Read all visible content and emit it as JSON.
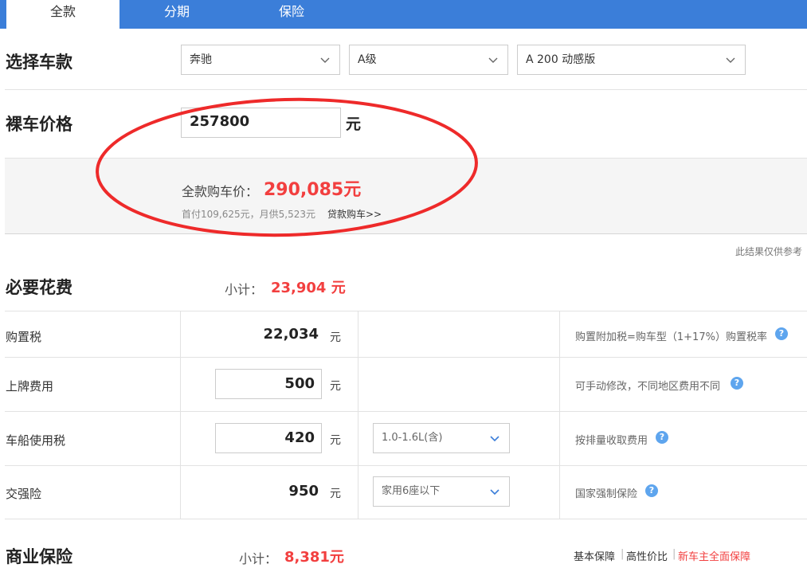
{
  "tabs": [
    {
      "label": "全款",
      "active": true
    },
    {
      "label": "分期",
      "active": false
    },
    {
      "label": "保险",
      "active": false
    }
  ],
  "select_model": {
    "title": "选择车款",
    "brand": "奔驰",
    "series": "A级",
    "model": "A 200 动感版"
  },
  "bare_price": {
    "title": "裸车价格",
    "value": "257800",
    "unit": "元"
  },
  "summary": {
    "full_label": "全款购车价：",
    "full_price": "290,085元",
    "loan_info": "首付109,625元，月供5,523元",
    "loan_link": "贷款购车>>",
    "note": "此结果仅供参考"
  },
  "necessary": {
    "title": "必要花费",
    "subtotal_label": "小计：",
    "subtotal_value": "23,904 元",
    "rows": [
      {
        "label": "购置税",
        "value": "22,034",
        "unit": "元",
        "desc": "购置附加税=购车型（1+17%）购置税率"
      },
      {
        "label": "上牌费用",
        "value": "500",
        "unit": "元",
        "desc": "可手动修改，不同地区费用不同"
      },
      {
        "label": "车船使用税",
        "value": "420",
        "unit": "元",
        "option": "1.0-1.6L(含)",
        "desc": "按排量收取费用"
      },
      {
        "label": "交强险",
        "value": "950",
        "unit": "元",
        "option": "家用6座以下",
        "desc": "国家强制保险"
      }
    ]
  },
  "commercial": {
    "title": "商业保险",
    "subtotal_label": "小计：",
    "subtotal_value": "8,381元",
    "links": [
      "基本保障",
      "高性价比",
      "新车主全面保障"
    ],
    "link_colors": [
      "#333333",
      "#333333",
      "#f23f3f"
    ]
  },
  "colors": {
    "accent_blue": "#3b7ed9",
    "price_red": "#f23f3f",
    "help_blue": "#5ea5ee",
    "annotation_red": "#ee2a2a"
  },
  "icons": {
    "dropdown": "chevron-down-icon",
    "help": "question-circle-icon"
  }
}
